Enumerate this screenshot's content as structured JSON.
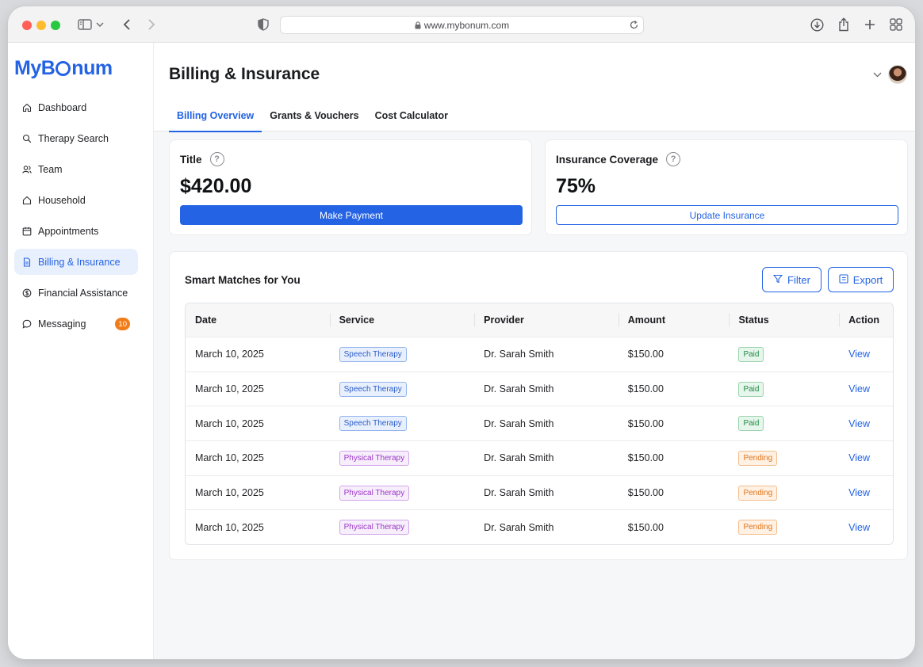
{
  "browser": {
    "url": "www.mybonum.com"
  },
  "brand": {
    "logo_pre": "MyB",
    "logo_post": "num",
    "color": "#2463e4"
  },
  "sidebar": {
    "items": [
      {
        "label": "Dashboard",
        "icon": "home-icon"
      },
      {
        "label": "Therapy Search",
        "icon": "search-icon"
      },
      {
        "label": "Team",
        "icon": "users-icon"
      },
      {
        "label": "Household",
        "icon": "house-icon"
      },
      {
        "label": "Appointments",
        "icon": "calendar-icon"
      },
      {
        "label": "Billing & Insurance",
        "icon": "document-icon",
        "active": true
      },
      {
        "label": "Financial Assistance",
        "icon": "dollar-icon"
      },
      {
        "label": "Messaging",
        "icon": "chat-icon",
        "badge": "10"
      }
    ]
  },
  "header": {
    "title": "Billing & Insurance",
    "tabs": [
      {
        "label": "Billing Overview",
        "active": true
      },
      {
        "label": "Grants & Vouchers"
      },
      {
        "label": "Cost Calculator"
      }
    ]
  },
  "cards": {
    "balance": {
      "label": "Title",
      "value": "$420.00",
      "button": "Make Payment"
    },
    "insurance": {
      "label": "Insurance Coverage",
      "value": "75%",
      "button": "Update Insurance"
    }
  },
  "matches": {
    "title": "Smart Matches for You",
    "filter_label": "Filter",
    "export_label": "Export",
    "columns": [
      "Date",
      "Service",
      "Provider",
      "Amount",
      "Status",
      "Action"
    ],
    "rows": [
      {
        "date": "March 10, 2025",
        "service": "Speech Therapy",
        "provider": "Dr. Sarah Smith",
        "amount": "$150.00",
        "status": "Paid",
        "action": "View"
      },
      {
        "date": "March 10, 2025",
        "service": "Speech Therapy",
        "provider": "Dr. Sarah Smith",
        "amount": "$150.00",
        "status": "Paid",
        "action": "View"
      },
      {
        "date": "March 10, 2025",
        "service": "Speech Therapy",
        "provider": "Dr. Sarah Smith",
        "amount": "$150.00",
        "status": "Paid",
        "action": "View"
      },
      {
        "date": "March 10, 2025",
        "service": "Physical Therapy",
        "provider": "Dr. Sarah Smith",
        "amount": "$150.00",
        "status": "Pending",
        "action": "View"
      },
      {
        "date": "March 10, 2025",
        "service": "Physical Therapy",
        "provider": "Dr. Sarah Smith",
        "amount": "$150.00",
        "status": "Pending",
        "action": "View"
      },
      {
        "date": "March 10, 2025",
        "service": "Physical Therapy",
        "provider": "Dr. Sarah Smith",
        "amount": "$150.00",
        "status": "Pending",
        "action": "View"
      }
    ]
  }
}
